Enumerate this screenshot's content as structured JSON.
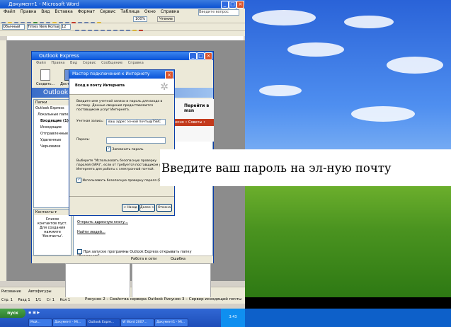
{
  "word": {
    "title": "Документ1 - Microsoft Word",
    "menu": [
      "Файл",
      "Правка",
      "Вид",
      "Вставка",
      "Формат",
      "Сервис",
      "Таблица",
      "Окно",
      "Справка"
    ],
    "ask_placeholder": "Введите вопрос",
    "style_value": "Обычный",
    "font_value": "Times New Roman",
    "size_value": "12",
    "zoom_value": "100%",
    "read_label": "Чтение",
    "status": {
      "page": "Стр. 1",
      "section": "Разд 1",
      "position": "1/1",
      "line": "Ст 1",
      "col": "Кол 1"
    },
    "drawing_label": "Рисование",
    "autoshapes_label": "Автофигуры",
    "captions": "Рисунок 2 – Свойства сервера Outlook          Рисунок 3 – Сервер исходящей почты"
  },
  "outlook": {
    "title": "Outlook Express",
    "menu": [
      "Файл",
      "Правка",
      "Вид",
      "Сервис",
      "Сообщение",
      "Справка"
    ],
    "tool_create": "Создать...",
    "tool_delivery": "Доставить",
    "banner": "Outlook Express",
    "folders_header": "Папки",
    "folders": [
      "Outlook Express",
      "Локальные папки",
      "Входящие (1)",
      "Исходящие",
      "Отправленные",
      "Удаленные",
      "Черновики"
    ],
    "contacts_header": "Контакты ▾",
    "contacts_text": "Список контактов пуст. Для создания нажмите 'Контакты'.",
    "magazine_logo": "Перейти в msn",
    "magazine_bar": "интересно • Советы •",
    "link_address_book": "Открыть адресную книгу...",
    "link_find_people": "Найти людей...",
    "startup_check": "При запуске программы Outlook Express открывать папку \"Входящие\".",
    "status_online": "Работа в сети",
    "status_error": "Ошибка"
  },
  "wizard": {
    "title": "Мастер подключения к Интернету",
    "heading": "Вход в почту Интернета",
    "intro": "Введите имя учетной записи и пароль для входа в систему. Данные сведения предоставляются поставщиком услуг Интернета.",
    "account_label": "Учетная запись:",
    "account_value": "ваш адрес эл-ной почты@TSBC",
    "password_label": "Пароль:",
    "password_value": "",
    "remember_label": "Запомнить пароль",
    "spa_text": "Выберите \"Использовать безопасную проверку паролей (SPA)\", если от требуется поставщиком услуг Интернета для работы с электронной почтой.",
    "spa_label": "Использовать безопасную проверку пароля (SPA)",
    "back_button": "< Назад",
    "next_button": "Далее >",
    "cancel_button": "Отмена"
  },
  "taskbar": {
    "start_label": "пуск",
    "tasks": [
      "Мой...",
      "Документ - Mi...",
      "Outlook Expre...",
      "W Word 2007...",
      "Документ1 - Mi..."
    ],
    "clock": "3:43"
  },
  "overlay": {
    "text": "Введите ваш пароль на эл-ную почту"
  }
}
